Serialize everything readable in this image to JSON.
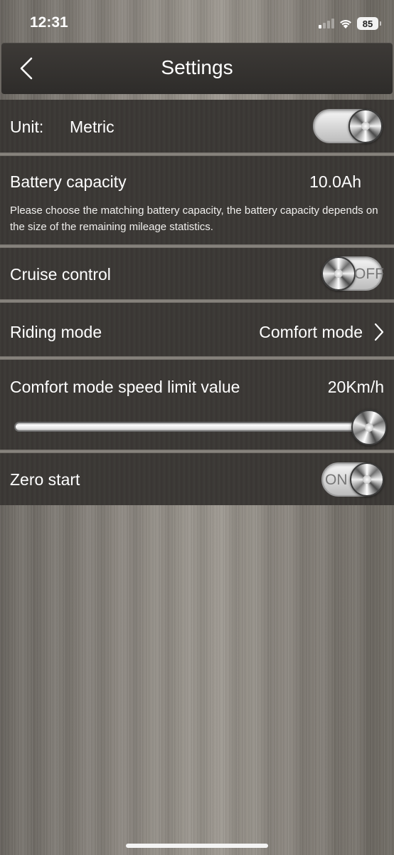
{
  "status_bar": {
    "time": "12:31",
    "battery": "85"
  },
  "header": {
    "title": "Settings",
    "back_icon": "chevron-left-icon"
  },
  "settings": {
    "unit": {
      "label": "Unit:",
      "value": "Metric",
      "toggle_on": true
    },
    "battery": {
      "label": "Battery capacity",
      "value": "10.0Ah",
      "description": "Please choose the matching battery capacity, the battery capacity depends on the size of the remaining mileage statistics."
    },
    "cruise": {
      "label": "Cruise control",
      "state_text": "OFF",
      "on": false
    },
    "riding_mode": {
      "label": "Riding mode",
      "value": "Comfort mode",
      "chevron": ">"
    },
    "speed_limit": {
      "label": "Comfort mode speed limit value",
      "value": "20Km/h",
      "slider_fraction": 1.0
    },
    "zero_start": {
      "label": "Zero start",
      "state_text": "ON",
      "on": true
    }
  },
  "colors": {
    "row_bg": "#3b3835",
    "text": "#ffffff",
    "toggle_track": "#d8d8d8"
  }
}
